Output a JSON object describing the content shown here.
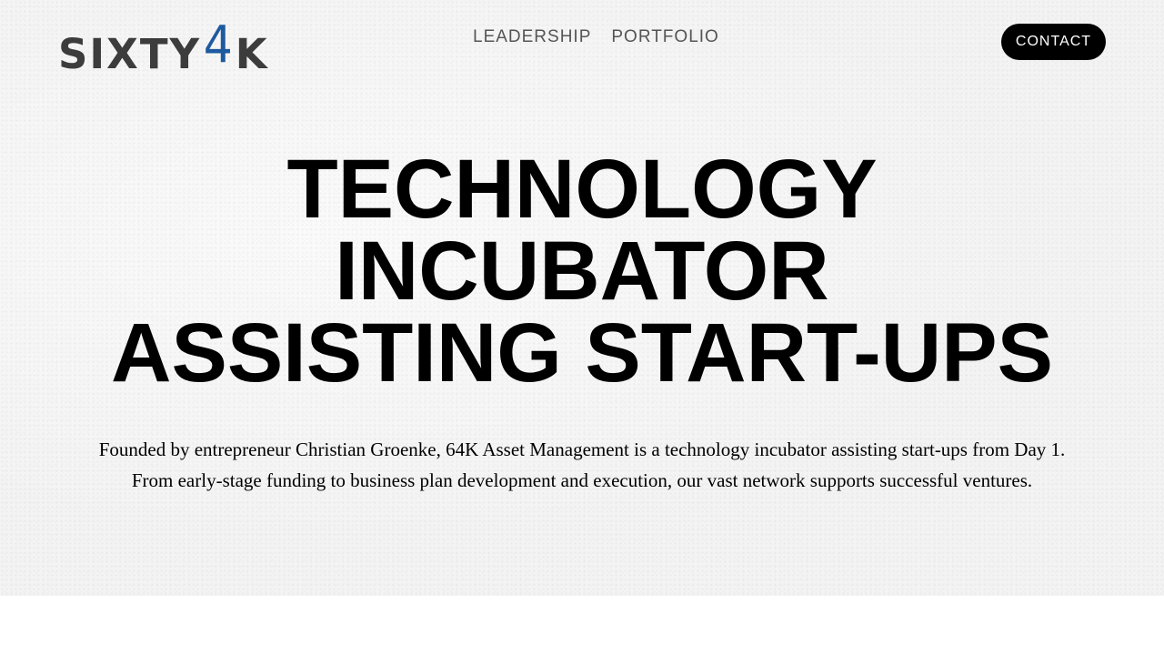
{
  "header": {
    "logo": {
      "part1": "SIXTY",
      "part2": "4",
      "part3": "K"
    },
    "nav": [
      {
        "label": "LEADERSHIP"
      },
      {
        "label": "PORTFOLIO"
      }
    ],
    "contact_label": "CONTACT"
  },
  "hero": {
    "headline": [
      "TECHNOLOGY",
      "INCUBATOR",
      "ASSISTING START-UPS"
    ],
    "description": [
      "Founded by entrepreneur Christian Groenke, 64K Asset Management is a technology incubator assisting start-ups from Day 1.",
      "From early-stage funding to business plan development and execution, our vast network supports successful ventures."
    ]
  },
  "colors": {
    "logo_gray": "#3c3c3c",
    "logo_blue": "#1e5aa0",
    "button_bg": "#000000",
    "hero_bg": "#f3f3f3"
  }
}
